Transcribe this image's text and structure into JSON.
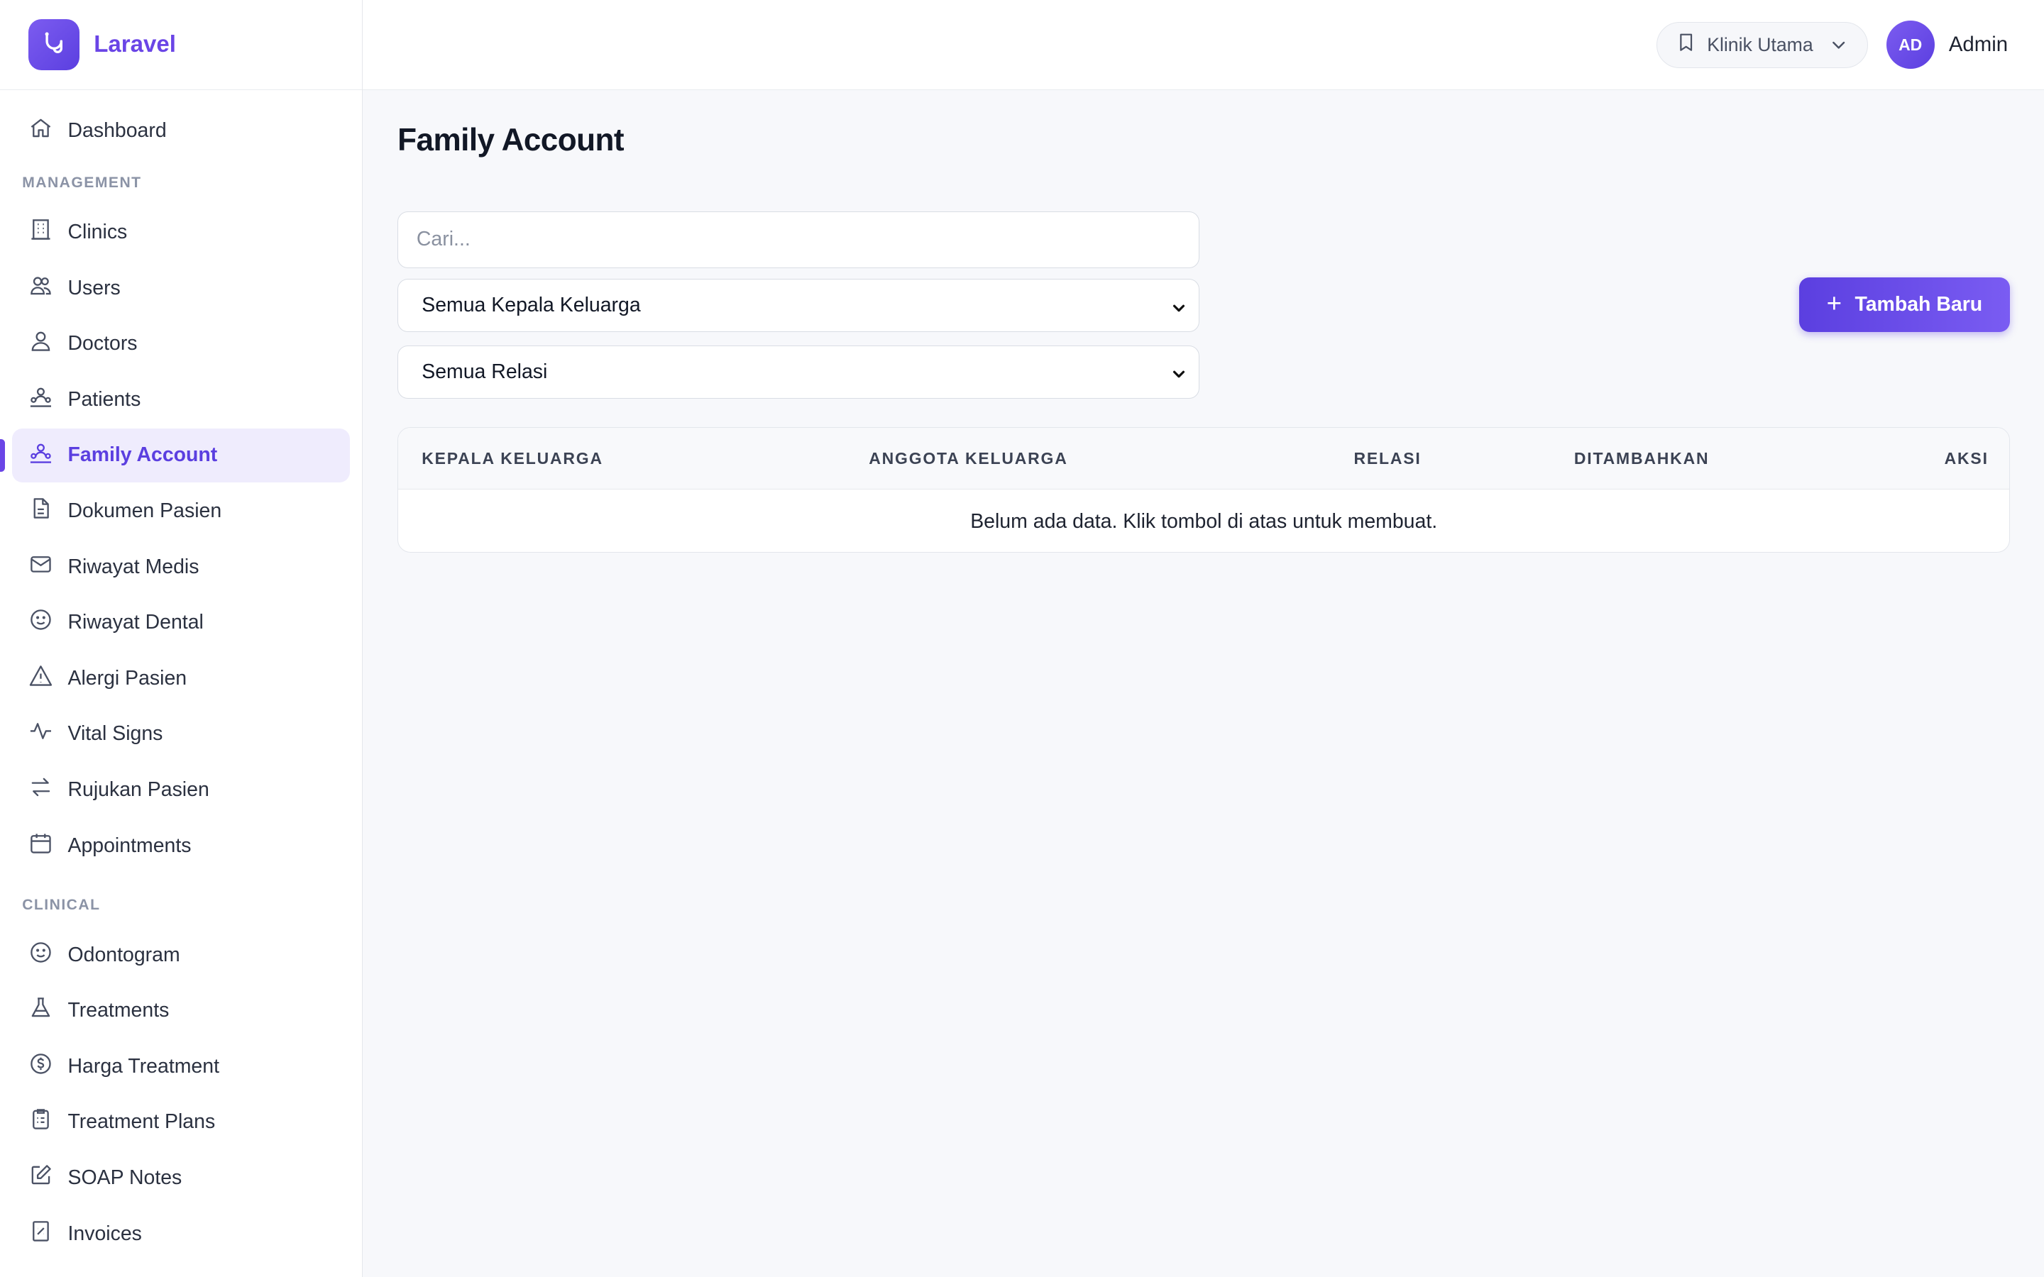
{
  "brand": {
    "name": "Laravel"
  },
  "sidebar": {
    "top_items": [
      {
        "label": "Dashboard",
        "icon": "home-icon"
      }
    ],
    "sections": [
      {
        "title": "MANAGEMENT",
        "items": [
          {
            "label": "Clinics",
            "icon": "building-icon"
          },
          {
            "label": "Users",
            "icon": "users-icon"
          },
          {
            "label": "Doctors",
            "icon": "user-icon"
          },
          {
            "label": "Patients",
            "icon": "user-group-icon"
          },
          {
            "label": "Family Account",
            "icon": "user-group-icon",
            "active": true
          },
          {
            "label": "Dokumen Pasien",
            "icon": "document-icon"
          },
          {
            "label": "Riwayat Medis",
            "icon": "envelope-icon"
          },
          {
            "label": "Riwayat Dental",
            "icon": "smile-icon"
          },
          {
            "label": "Alergi Pasien",
            "icon": "warning-icon"
          },
          {
            "label": "Vital Signs",
            "icon": "pulse-icon"
          },
          {
            "label": "Rujukan Pasien",
            "icon": "arrows-exchange-icon"
          },
          {
            "label": "Appointments",
            "icon": "calendar-icon"
          }
        ]
      },
      {
        "title": "CLINICAL",
        "items": [
          {
            "label": "Odontogram",
            "icon": "smile-icon"
          },
          {
            "label": "Treatments",
            "icon": "flask-icon"
          },
          {
            "label": "Harga Treatment",
            "icon": "dollar-circle-icon"
          },
          {
            "label": "Treatment Plans",
            "icon": "clipboard-icon"
          },
          {
            "label": "SOAP Notes",
            "icon": "edit-icon"
          },
          {
            "label": "Invoices",
            "icon": "receipt-icon"
          }
        ]
      }
    ]
  },
  "header": {
    "clinic": "Klinik Utama",
    "avatar_initials": "AD",
    "user_name": "Admin"
  },
  "page": {
    "title": "Family Account",
    "search_placeholder": "Cari...",
    "filter_head": "Semua Kepala Keluarga",
    "filter_relation": "Semua Relasi",
    "add_button": "Tambah Baru"
  },
  "table": {
    "columns": [
      "KEPALA KELUARGA",
      "ANGGOTA KELUARGA",
      "RELASI",
      "DITAMBAHKAN",
      "AKSI"
    ],
    "empty_message": "Belum ada data. Klik tombol di atas untuk membuat."
  },
  "colors": {
    "accent": "#6a45e6",
    "accent_dark": "#5b3fe0",
    "active_bg": "#efecfd"
  }
}
